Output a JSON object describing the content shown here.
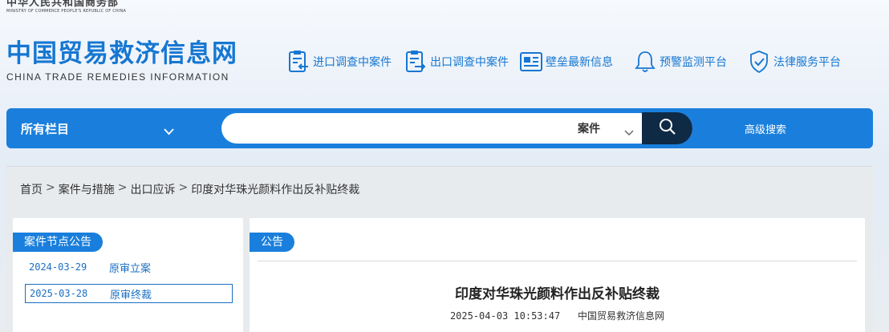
{
  "ministry": {
    "name_cn": "中华人民共和国商务部",
    "name_en": "MINISTRY OF COMMERCE PEOPLE'S REPUBLIC OF CHINA"
  },
  "site": {
    "title_cn": "中国贸易救济信息网",
    "title_en": "CHINA TRADE REMEDIES INFORMATION"
  },
  "quicklinks": [
    {
      "label": "进口调查中案件",
      "icon": "document-import-icon"
    },
    {
      "label": "出口调查中案件",
      "icon": "document-export-icon"
    },
    {
      "label": "壁垒最新信息",
      "icon": "news-icon"
    },
    {
      "label": "预警监测平台",
      "icon": "bell-icon"
    },
    {
      "label": "法律服务平台",
      "icon": "shield-check-icon"
    }
  ],
  "search": {
    "category": "所有栏目",
    "type": "案件",
    "value": "",
    "advanced_label": "高级搜索"
  },
  "breadcrumb": [
    "首页",
    "案件与措施",
    "出口应诉",
    "印度对华珠光颜料作出反补贴终裁"
  ],
  "left_panel": {
    "tag": "案件节点公告",
    "items": [
      {
        "date": "2024-03-29",
        "title": "原审立案",
        "active": false
      },
      {
        "date": "2025-03-28",
        "title": "原审终裁",
        "active": true
      }
    ]
  },
  "right_panel": {
    "tag": "公告",
    "article_title": "印度对华珠光颜料作出反补贴终裁",
    "datetime": "2025-04-03 10:53:47",
    "source": "中国贸易救济信息网"
  },
  "colors": {
    "brand_blue": "#1a7fdc",
    "dark_navy": "#0f2a45",
    "link_blue": "#1a6fc2"
  }
}
